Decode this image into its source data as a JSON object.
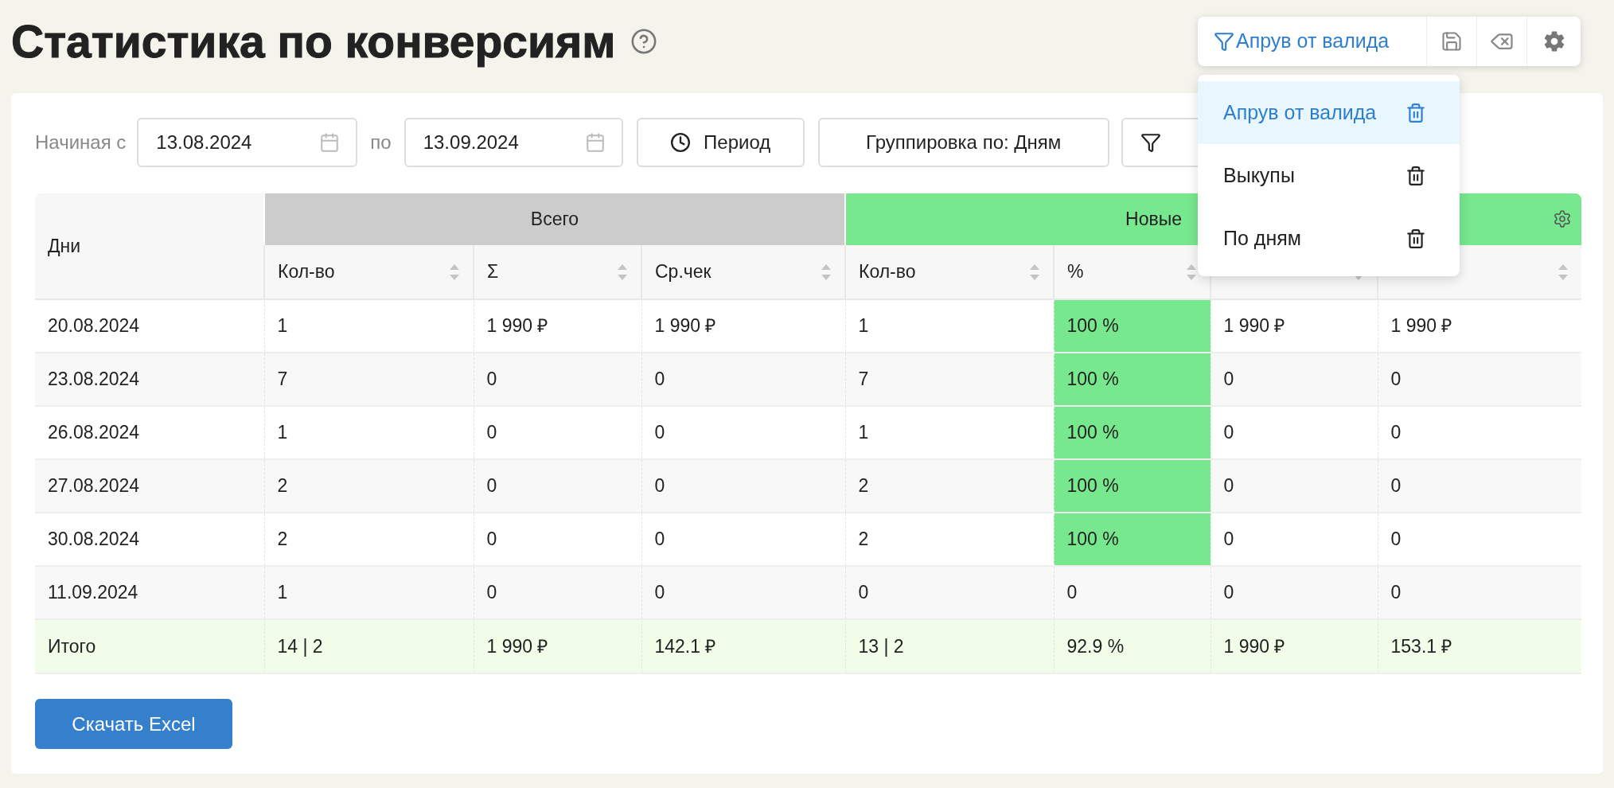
{
  "title": "Статистика по конверсиям",
  "saved_filters": {
    "active": "Апрув от валида",
    "items": [
      {
        "label": "Апрув от валида",
        "selected": true
      },
      {
        "label": "Выкупы",
        "selected": false
      },
      {
        "label": "По дням",
        "selected": false
      }
    ]
  },
  "filters": {
    "from_label": "Начиная с",
    "from": "13.08.2024",
    "to_label": "по",
    "to": "13.09.2024",
    "period_button": "Период",
    "grouping_button": "Группировка по: Дням"
  },
  "table": {
    "first_column": "Дни",
    "groups": [
      {
        "label": "Всего",
        "color": "#cccccc",
        "columns": [
          "Кол-во",
          "Σ",
          "Ср.чек"
        ]
      },
      {
        "label": "Новые",
        "color": "#77e88e",
        "columns": [
          "Кол-во",
          "%"
        ],
        "covered_columns": [
          {
            "covered": true
          },
          {
            "covered": true
          }
        ]
      }
    ],
    "rows": [
      {
        "day": "20.08.2024",
        "cells": [
          "1",
          "1 990 ₽",
          "1 990 ₽",
          "1",
          "100 %",
          "1 990 ₽",
          "1 990 ₽"
        ],
        "percent_highlighted": true
      },
      {
        "day": "23.08.2024",
        "cells": [
          "7",
          "0",
          "0",
          "7",
          "100 %",
          "0",
          "0"
        ],
        "percent_highlighted": true
      },
      {
        "day": "26.08.2024",
        "cells": [
          "1",
          "0",
          "0",
          "1",
          "100 %",
          "0",
          "0"
        ],
        "percent_highlighted": true
      },
      {
        "day": "27.08.2024",
        "cells": [
          "2",
          "0",
          "0",
          "2",
          "100 %",
          "0",
          "0"
        ],
        "percent_highlighted": true
      },
      {
        "day": "30.08.2024",
        "cells": [
          "2",
          "0",
          "0",
          "2",
          "100 %",
          "0",
          "0"
        ],
        "percent_highlighted": true
      },
      {
        "day": "11.09.2024",
        "cells": [
          "1",
          "0",
          "0",
          "0",
          "0",
          "0",
          "0"
        ],
        "percent_highlighted": false
      }
    ],
    "total": {
      "label": "Итого",
      "cells": [
        "14 | 2",
        "1 990 ₽",
        "142.1 ₽",
        "13 | 2",
        "92.9 %",
        "1 990 ₽",
        "153.1 ₽"
      ]
    }
  },
  "download_button": "Скачать Excel"
}
